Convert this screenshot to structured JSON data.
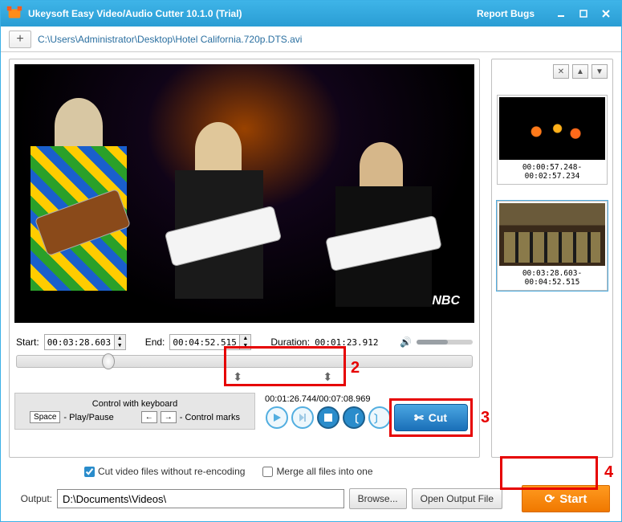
{
  "titlebar": {
    "title": "Ukeysoft Easy Video/Audio Cutter 10.1.0 (Trial)",
    "report_bugs": "Report Bugs"
  },
  "path": "C:\\Users\\Administrator\\Desktop\\Hotel California.720p.DTS.avi",
  "time": {
    "start_label": "Start:",
    "start_value": "00:03:28.603",
    "end_label": "End:",
    "end_value": "00:04:52.515",
    "duration_label": "Duration:",
    "duration_value": "00:01:23.912"
  },
  "clip_time": "00:01:26.744/00:07:08.969",
  "keyboard": {
    "title": "Control with keyboard",
    "space": "Space",
    "play": "- Play/Pause",
    "left": "←",
    "right": "→",
    "marks": "- Control marks"
  },
  "cut_label": "Cut",
  "thumbs": [
    {
      "range": "00:00:57.248-00:02:57.234"
    },
    {
      "range": "00:03:28.603-00:04:52.515"
    }
  ],
  "options": {
    "no_reencode": "Cut video files without re-encoding",
    "merge": "Merge all files into one"
  },
  "output": {
    "label": "Output:",
    "path": "D:\\Documents\\Videos\\",
    "browse": "Browse...",
    "open": "Open Output File"
  },
  "start_label": "Start",
  "annotations": {
    "n2": "2",
    "n3": "3",
    "n4": "4"
  },
  "nbc": "NBC"
}
